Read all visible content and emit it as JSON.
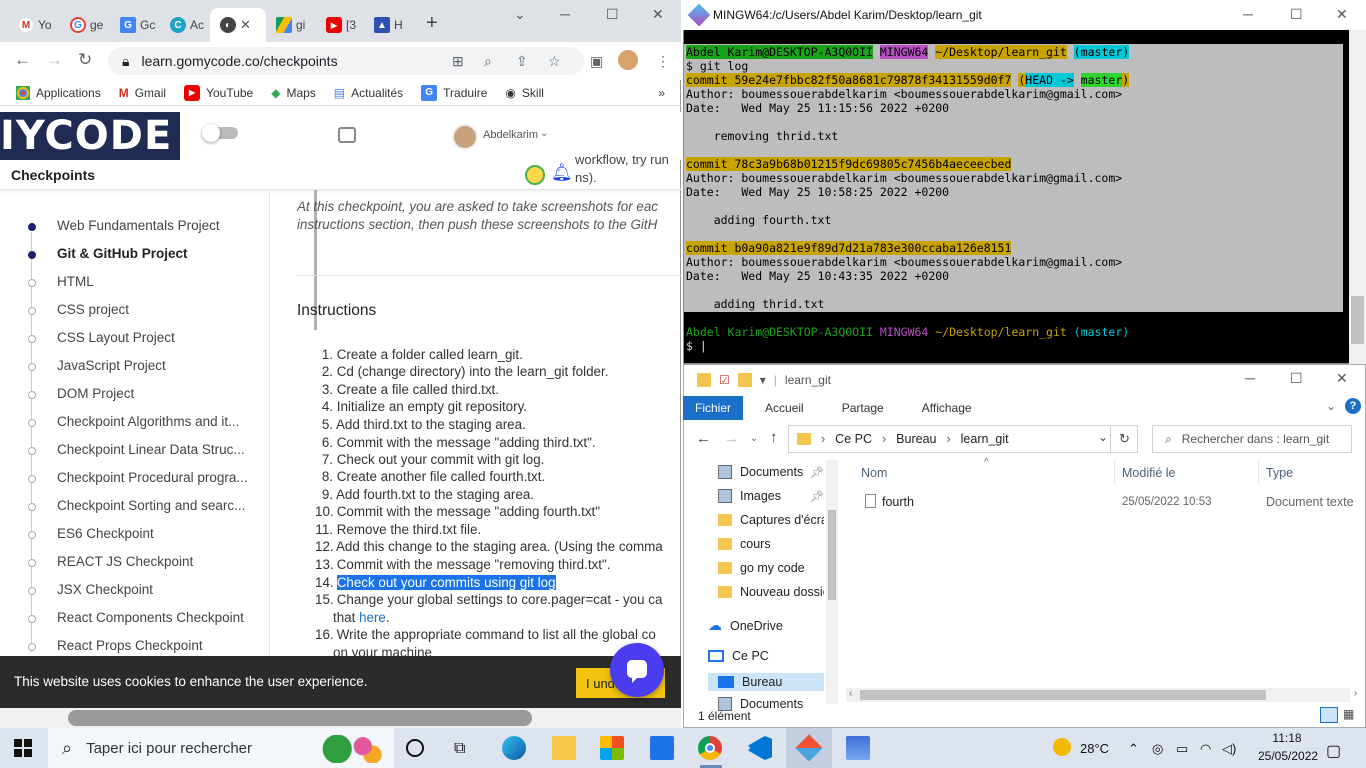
{
  "chrome": {
    "tabs": [
      {
        "label": "Yo",
        "icon": "gmail-icon"
      },
      {
        "label": "ge",
        "icon": "google-icon"
      },
      {
        "label": "Gc",
        "icon": "translate-icon"
      },
      {
        "label": "Ac",
        "icon": "ac-icon"
      },
      {
        "label": "",
        "icon": "gomycode-icon"
      },
      {
        "label": "gi",
        "icon": "drive-icon"
      },
      {
        "label": "[3",
        "icon": "youtube-icon"
      },
      {
        "label": "H",
        "icon": "h-icon"
      }
    ],
    "url": "learn.gomycode.co/checkpoints",
    "bookmarks": [
      "Applications",
      "Gmail",
      "YouTube",
      "Maps",
      "Actualités",
      "Traduire",
      "Skill"
    ]
  },
  "site": {
    "logo": "IYCODE",
    "user": "Abdelkarim",
    "page_title": "Checkpoints",
    "intro_fragment": [
      "workflow, try run",
      "ns)."
    ],
    "intro_text": [
      "At this checkpoint, you are asked to take screenshots for eac",
      "instructions section, then push these screenshots to the GitH"
    ],
    "instructions_heading": "Instructions",
    "sidebar": [
      "Web Fundamentals Project",
      "Git & GitHub Project",
      "HTML",
      "CSS project",
      "CSS Layout Project",
      "JavaScript Project",
      "DOM Project",
      "Checkpoint Algorithms and it...",
      "Checkpoint Linear Data Struc...",
      "Checkpoint Procedural progra...",
      "Checkpoint Sorting and searc...",
      "ES6 Checkpoint",
      "REACT JS Checkpoint",
      "JSX Checkpoint",
      "React Components Checkpoint",
      "React Props Checkpoint"
    ],
    "instructions": [
      "Create a folder called learn_git.",
      "Cd (change directory) into the learn_git folder.",
      "Create a file called third.txt.",
      "Initialize an empty git repository.",
      "Add third.txt to the staging area.",
      "Commit with the message \"adding third.txt\".",
      "Check out your commit with git log.",
      "Create another file called fourth.txt.",
      "Add fourth.txt to the staging area.",
      "Commit with the message \"adding fourth.txt\"",
      "Remove the third.txt file.",
      "Add this change to the staging area. (Using the comma",
      "Commit with the message \"removing third.txt\".",
      "Check out your commits using git log",
      "Change your global settings to core.pager=cat - you ca",
      "Write the appropriate command to list all the global co"
    ],
    "instr15_cont_prefix": "that ",
    "instr15_link": "here",
    "instr16_cont": "on your machine",
    "cookie_text": "This website uses cookies to enhance the user experience.",
    "cookie_button": "I understand"
  },
  "terminal": {
    "title": "MINGW64:/c/Users/Abdel Karim/Desktop/learn_git",
    "prompt_user": "Abdel Karim@DESKTOP-A3Q0OII",
    "prompt_env": "MINGW64",
    "prompt_path": "~/Desktop/learn_git",
    "prompt_branch": "(master)",
    "command": "$ git log",
    "commits": [
      {
        "hash": "commit 59e24e7fbbc82f50a8681c79878f34131559d0f7",
        "refs": true,
        "author": "Author: boumessouerabdelkarim <boumessouerabdelkarim@gmail.com>",
        "date": "Date:   Wed May 25 11:15:56 2022 +0200",
        "msg": "    removing thrid.txt"
      },
      {
        "hash": "commit 78c3a9b68b01215f9dc69805c7456b4aeceecbed",
        "refs": false,
        "author": "Author: boumessouerabdelkarim <boumessouerabdelkarim@gmail.com>",
        "date": "Date:   Wed May 25 10:58:25 2022 +0200",
        "msg": "    adding fourth.txt"
      },
      {
        "hash": "commit b0a90a821e9f89d7d21a783e300ccaba126e8151",
        "refs": false,
        "author": "Author: boumessouerabdelkarim <boumessouerabdelkarim@gmail.com>",
        "date": "Date:   Wed May 25 10:43:35 2022 +0200",
        "msg": "    adding thrid.txt"
      }
    ],
    "head_ref": "HEAD ->",
    "master_ref": "master",
    "cursor_prompt": "$ |"
  },
  "explorer": {
    "title": "learn_git",
    "ribbon": [
      "Fichier",
      "Accueil",
      "Partage",
      "Affichage"
    ],
    "path": [
      "Ce PC",
      "Bureau",
      "learn_git"
    ],
    "search_placeholder": "Rechercher dans : learn_git",
    "nav": [
      "Documents",
      "Images",
      "Captures d'écran",
      "cours",
      "go my code",
      "Nouveau dossier",
      "OneDrive",
      "Ce PC",
      "Bureau",
      "Documents"
    ],
    "columns": [
      "Nom",
      "Modifié le",
      "Type"
    ],
    "files": [
      {
        "name": "fourth",
        "modified": "25/05/2022 10:53",
        "type": "Document texte"
      }
    ],
    "status": "1 élément"
  },
  "taskbar": {
    "search_placeholder": "Taper ici pour rechercher",
    "temperature": "28°C",
    "time": "11:18",
    "date": "25/05/2022"
  },
  "colors": {
    "accent": "#1a6fc9",
    "terminal_bg": "#000000",
    "logo_bg": "#1f2b53"
  }
}
